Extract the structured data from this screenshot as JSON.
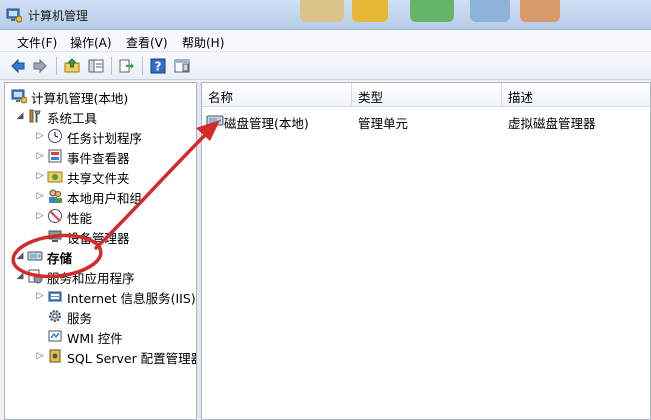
{
  "window": {
    "title": "计算机管理"
  },
  "menu": [
    {
      "label": "文件(F)"
    },
    {
      "label": "操作(A)"
    },
    {
      "label": "查看(V)"
    },
    {
      "label": "帮助(H)"
    }
  ],
  "toolbar": {
    "buttons": [
      {
        "icon": "back-arrow-icon"
      },
      {
        "icon": "forward-arrow-icon"
      },
      {
        "icon": "up-folder-icon"
      },
      {
        "icon": "show-hide-tree-icon"
      },
      {
        "icon": "export-list-icon"
      },
      {
        "icon": "help-icon"
      },
      {
        "icon": "properties-view-icon"
      }
    ]
  },
  "tree": {
    "root": {
      "label": "计算机管理(本地)"
    },
    "system_tools": {
      "label": "系统工具"
    },
    "task_scheduler": {
      "label": "任务计划程序"
    },
    "event_viewer": {
      "label": "事件查看器"
    },
    "shared_folders": {
      "label": "共享文件夹"
    },
    "local_users": {
      "label": "本地用户和组"
    },
    "performance": {
      "label": "性能"
    },
    "device_manager": {
      "label": "设备管理器"
    },
    "storage": {
      "label": "存储"
    },
    "services_apps": {
      "label": "服务和应用程序"
    },
    "iis": {
      "label": "Internet 信息服务(IIS)管"
    },
    "services": {
      "label": "服务"
    },
    "wmi": {
      "label": "WMI 控件"
    },
    "sql": {
      "label": "SQL Server 配置管理器"
    }
  },
  "list": {
    "columns": [
      {
        "label": "名称"
      },
      {
        "label": "类型"
      },
      {
        "label": "描述"
      }
    ],
    "rows": [
      {
        "name": "磁盘管理(本地)",
        "type": "管理单元",
        "description": "虚拟磁盘管理器"
      }
    ]
  },
  "annotation": {
    "color": "#d42a2a"
  }
}
